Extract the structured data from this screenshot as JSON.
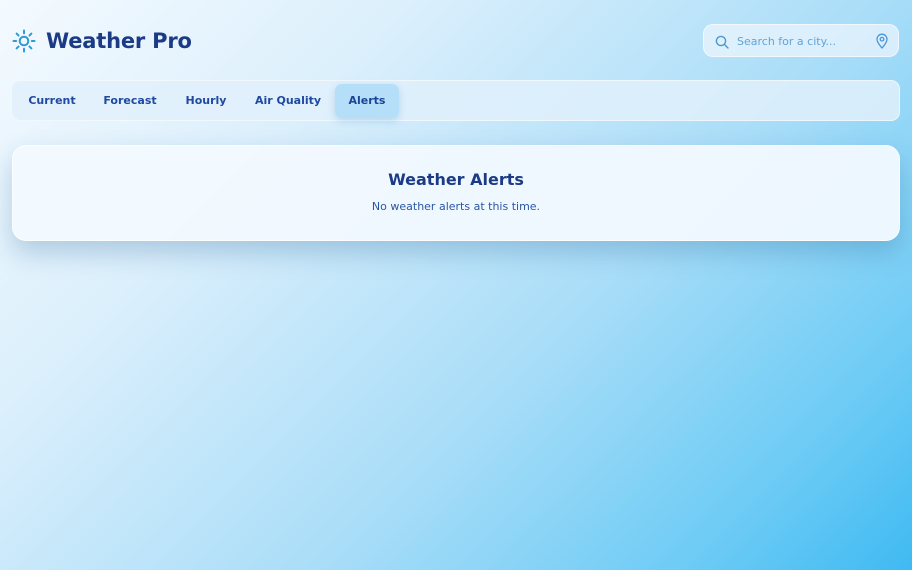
{
  "app": {
    "title": "Weather Pro",
    "logo_icon": "sun-icon"
  },
  "search": {
    "placeholder": "Search for a city...",
    "value": "",
    "search_icon": "search-icon",
    "location_icon": "location-pin-icon"
  },
  "tabs": [
    {
      "label": "Current",
      "active": false
    },
    {
      "label": "Forecast",
      "active": false
    },
    {
      "label": "Hourly",
      "active": false
    },
    {
      "label": "Air Quality",
      "active": false
    },
    {
      "label": "Alerts",
      "active": true
    }
  ],
  "alerts": {
    "title": "Weather Alerts",
    "message": "No weather alerts at this time."
  },
  "colors": {
    "primary_text": "#1c3b86",
    "accent": "#3b9fe0",
    "active_tab": "#b5dff8",
    "background_end": "#3fbaf2"
  }
}
